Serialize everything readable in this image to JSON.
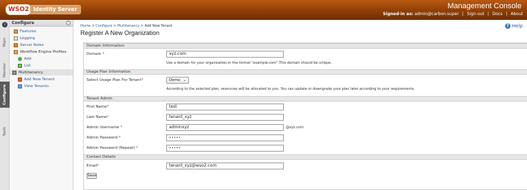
{
  "header": {
    "logo_brand": "WSO2",
    "logo_product": "Identity Server",
    "console_title": "Management Console",
    "signed_in_label": "Signed-in as:",
    "signed_in_user": "admin@carbon.super",
    "sign_out": "Sign-out",
    "docs": "Docs",
    "about": "About",
    "separator": "|"
  },
  "vtabs": [
    "Main",
    "Monitor",
    "Configure",
    "Tools"
  ],
  "menu": {
    "title": "Configure",
    "items": [
      {
        "label": "Features",
        "icon": "features-icon"
      },
      {
        "label": "Logging",
        "icon": "logging-icon"
      },
      {
        "label": "Server Roles",
        "icon": "server-roles-icon"
      },
      {
        "label": "Workflow Engine Profiles",
        "icon": "workflow-icon"
      },
      {
        "label": "Add",
        "icon": "add-icon"
      },
      {
        "label": "List",
        "icon": "list-icon"
      },
      {
        "label": "Multitenancy",
        "icon": "multitenancy-icon"
      },
      {
        "label": "Add New Tenant",
        "icon": "add-tenant-icon"
      },
      {
        "label": "View Tenants",
        "icon": "view-tenants-icon"
      }
    ]
  },
  "breadcrumb": {
    "home": "Home",
    "configure": "Configure",
    "multitenancy": "Multitenancy",
    "current": "Add New Tenant",
    "sep": ">"
  },
  "page_title": "Register A New Organization",
  "help": "Help",
  "form": {
    "domain_section": "Domain Information",
    "domain_label": "Domain",
    "domain_value": "xyz.com",
    "domain_hint": "Use a domain for your organization,in the format \"example.com\",This domain should be unique.",
    "usage_section": "Usage Plan Information",
    "usage_label": "Select Usage Plan For Tenant",
    "usage_value": "Demo",
    "usage_hint": "According to the selected plan, resources will be allocated to you. You can update or downgrade your plan later according to your requirements.",
    "admin_section": "Tenant Admin",
    "first_name_label": "First Name",
    "first_name_value": "test",
    "last_name_label": "Last Name",
    "last_name_value": "tenant_xyz",
    "username_label": "Admin Username",
    "username_value": "adminxyz",
    "username_suffix": "@xyz.com",
    "password_label": "Admin Password",
    "password_value": "•••••",
    "password_repeat_label": "Admin Password (Repeat)",
    "password_repeat_value": "•••••",
    "contact_section": "Contact Details",
    "email_label": "Email",
    "email_value": "tenant_xyz@wso2.com",
    "required_mark": "*",
    "save_label": "Save"
  }
}
